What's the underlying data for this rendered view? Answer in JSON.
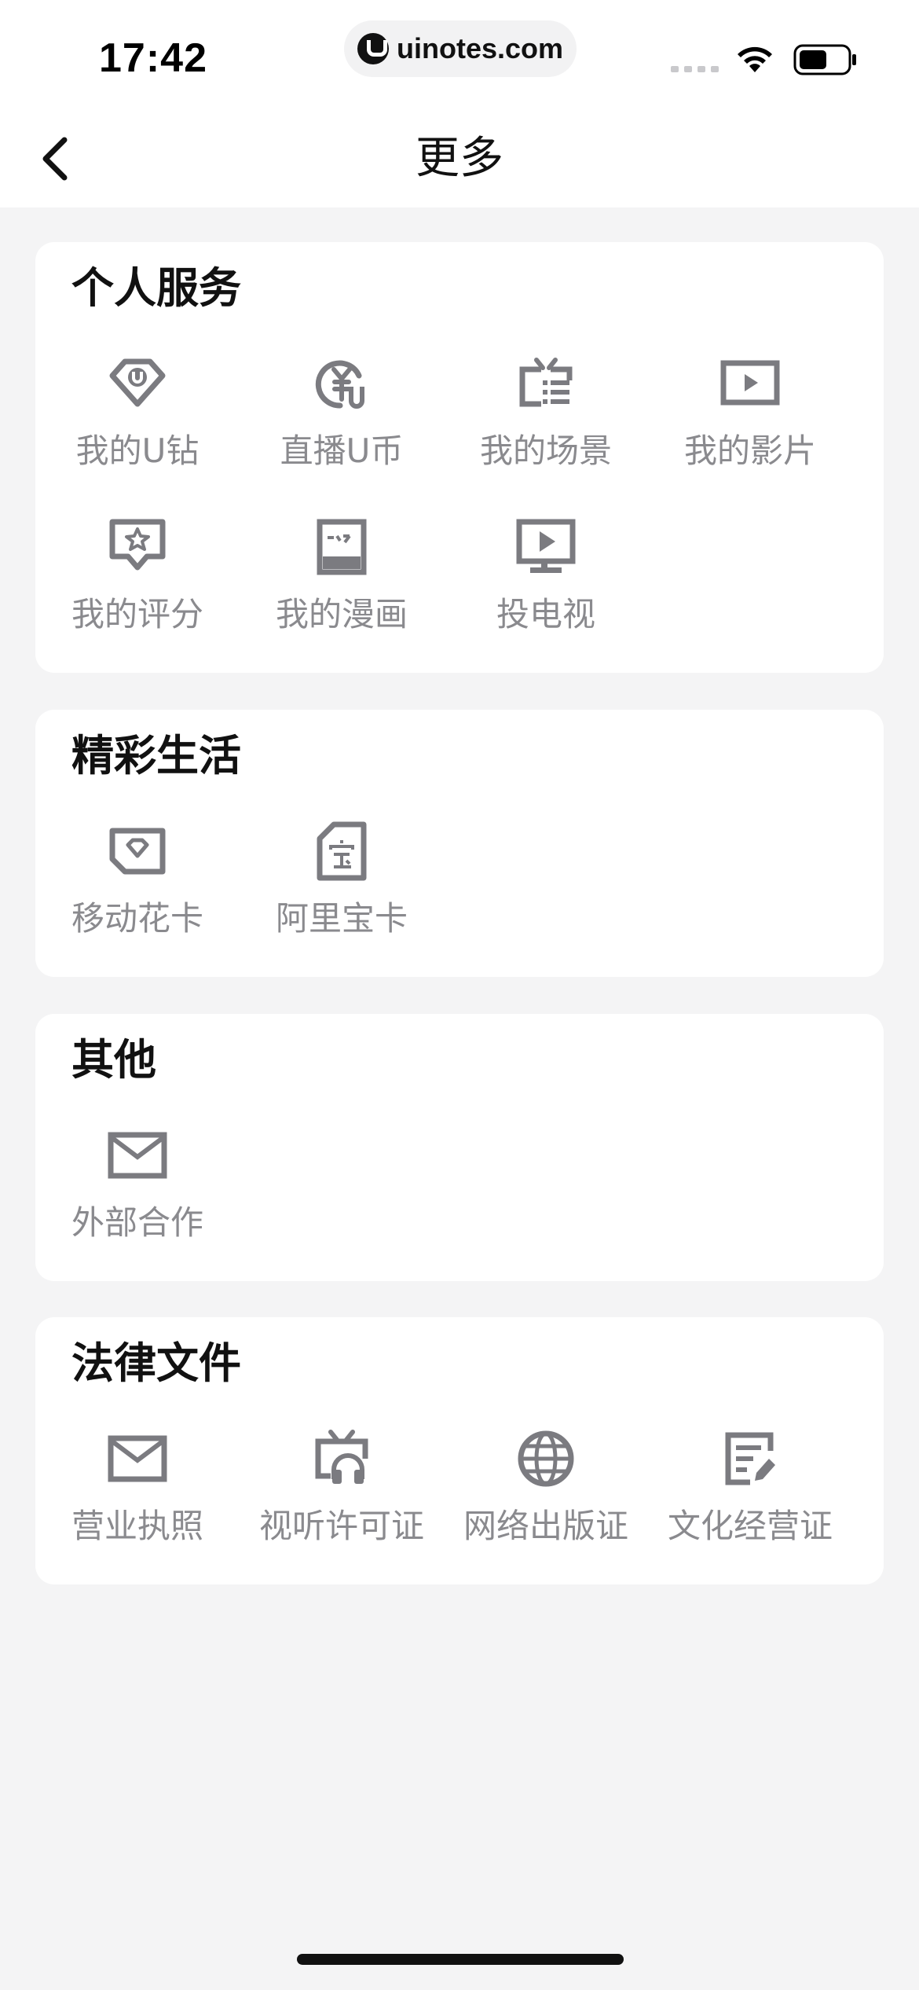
{
  "status_bar": {
    "time": "17:42",
    "url": "uinotes.com"
  },
  "nav": {
    "title": "更多"
  },
  "sections": [
    {
      "title": "个人服务",
      "items": [
        {
          "label": "我的U钻",
          "icon": "diamond-u-icon"
        },
        {
          "label": "直播U币",
          "icon": "yen-coin-icon"
        },
        {
          "label": "我的场景",
          "icon": "tv-list-icon"
        },
        {
          "label": "我的影片",
          "icon": "play-video-icon"
        },
        {
          "label": "我的评分",
          "icon": "star-rating-icon"
        },
        {
          "label": "我的漫画",
          "icon": "comic-book-icon"
        },
        {
          "label": "投电视",
          "icon": "cast-tv-icon"
        }
      ]
    },
    {
      "title": "精彩生活",
      "items": [
        {
          "label": "移动花卡",
          "icon": "sim-card-diamond-icon"
        },
        {
          "label": "阿里宝卡",
          "icon": "sim-card-bao-icon"
        }
      ]
    },
    {
      "title": "其他",
      "items": [
        {
          "label": "外部合作",
          "icon": "envelope-icon"
        }
      ]
    },
    {
      "title": "法律文件",
      "items": [
        {
          "label": "营业执照",
          "icon": "envelope-icon"
        },
        {
          "label": "视听许可证",
          "icon": "tv-headphones-icon"
        },
        {
          "label": "网络出版证",
          "icon": "globe-icon"
        },
        {
          "label": "文化经营证",
          "icon": "document-edit-icon"
        }
      ]
    }
  ],
  "colors": {
    "icon": "#7b7b80",
    "label": "#8a8a8e",
    "background": "#f4f4f5",
    "card": "#ffffff"
  }
}
